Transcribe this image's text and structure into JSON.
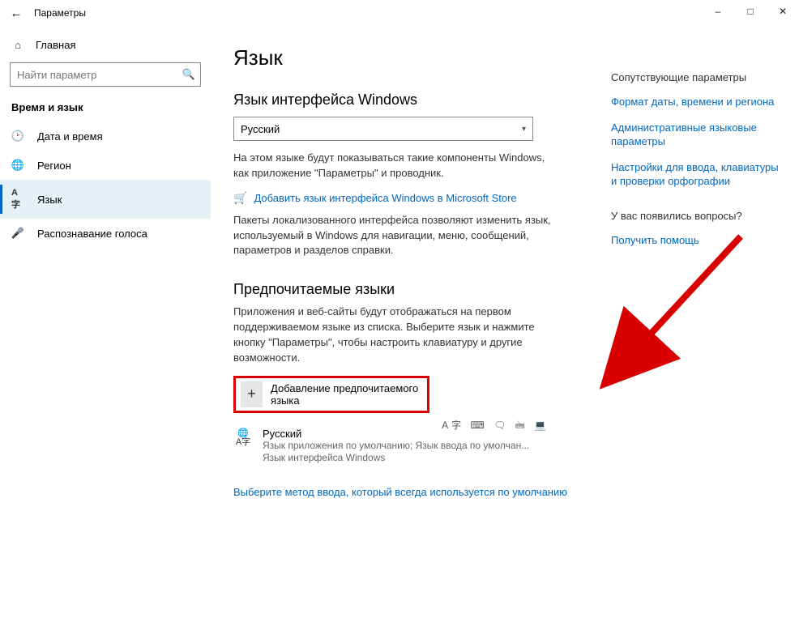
{
  "titlebar": {
    "title": "Параметры"
  },
  "sidebar": {
    "home": "Главная",
    "search_placeholder": "Найти параметр",
    "section": "Время и язык",
    "items": [
      {
        "icon": "clock",
        "label": "Дата и время"
      },
      {
        "icon": "globe",
        "label": "Регион"
      },
      {
        "icon": "lang",
        "label": "Язык",
        "selected": true
      },
      {
        "icon": "mic",
        "label": "Распознавание голоса"
      }
    ]
  },
  "main": {
    "page_title": "Язык",
    "display_lang_heading": "Язык интерфейса Windows",
    "combo_value": "Русский",
    "display_lang_desc": "На этом языке будут показываться такие компоненты Windows, как приложение \"Параметры\" и проводник.",
    "store_link": "Добавить язык интерфейса Windows в Microsoft Store",
    "lip_desc": "Пакеты локализованного интерфейса позволяют изменить язык, используемый в Windows для навигации, меню, сообщений, параметров и разделов справки.",
    "pref_heading": "Предпочитаемые языки",
    "pref_desc": "Приложения и веб-сайты будут отображаться на первом поддерживаемом языке из списка. Выберите язык и нажмите кнопку \"Параметры\", чтобы настроить клавиатуру и другие возможности.",
    "add_lang_label": "Добавление предпочитаемого языка",
    "lang_entry": {
      "name": "Русский",
      "sub1": "Язык приложения по умолчанию; Язык ввода по умолчан...",
      "sub2": "Язык интерфейса Windows"
    },
    "input_method_link": "Выберите метод ввода, который всегда используется по умолчанию"
  },
  "right": {
    "heading1": "Сопутствующие параметры",
    "links1": [
      "Формат даты, времени и региона",
      "Административные языковые параметры",
      "Настройки для ввода, клавиатуры и проверки орфографии"
    ],
    "heading2": "У вас появились вопросы?",
    "help_link": "Получить помощь"
  }
}
